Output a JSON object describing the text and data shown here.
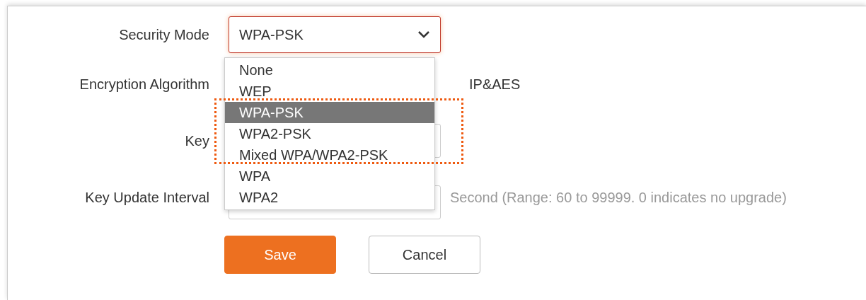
{
  "security_mode": {
    "label": "Security Mode",
    "value": "WPA-PSK",
    "focused": true,
    "options": [
      {
        "label": "None",
        "selected": false
      },
      {
        "label": "WEP",
        "selected": false
      },
      {
        "label": "WPA-PSK",
        "selected": true
      },
      {
        "label": "WPA2-PSK",
        "selected": false
      },
      {
        "label": "Mixed WPA/WPA2-PSK",
        "selected": false
      },
      {
        "label": "WPA",
        "selected": false
      },
      {
        "label": "WPA2",
        "selected": false
      }
    ]
  },
  "encryption": {
    "label": "Encryption Algorithm",
    "value_visible": "IP&AES"
  },
  "key": {
    "label": "Key"
  },
  "key_update": {
    "label": "Key Update Interval",
    "hint": "Second (Range: 60 to 99999. 0 indicates no upgrade)"
  },
  "buttons": [
    {
      "label": "Save",
      "kind": "primary"
    },
    {
      "label": "Cancel",
      "kind": "secondary"
    }
  ]
}
